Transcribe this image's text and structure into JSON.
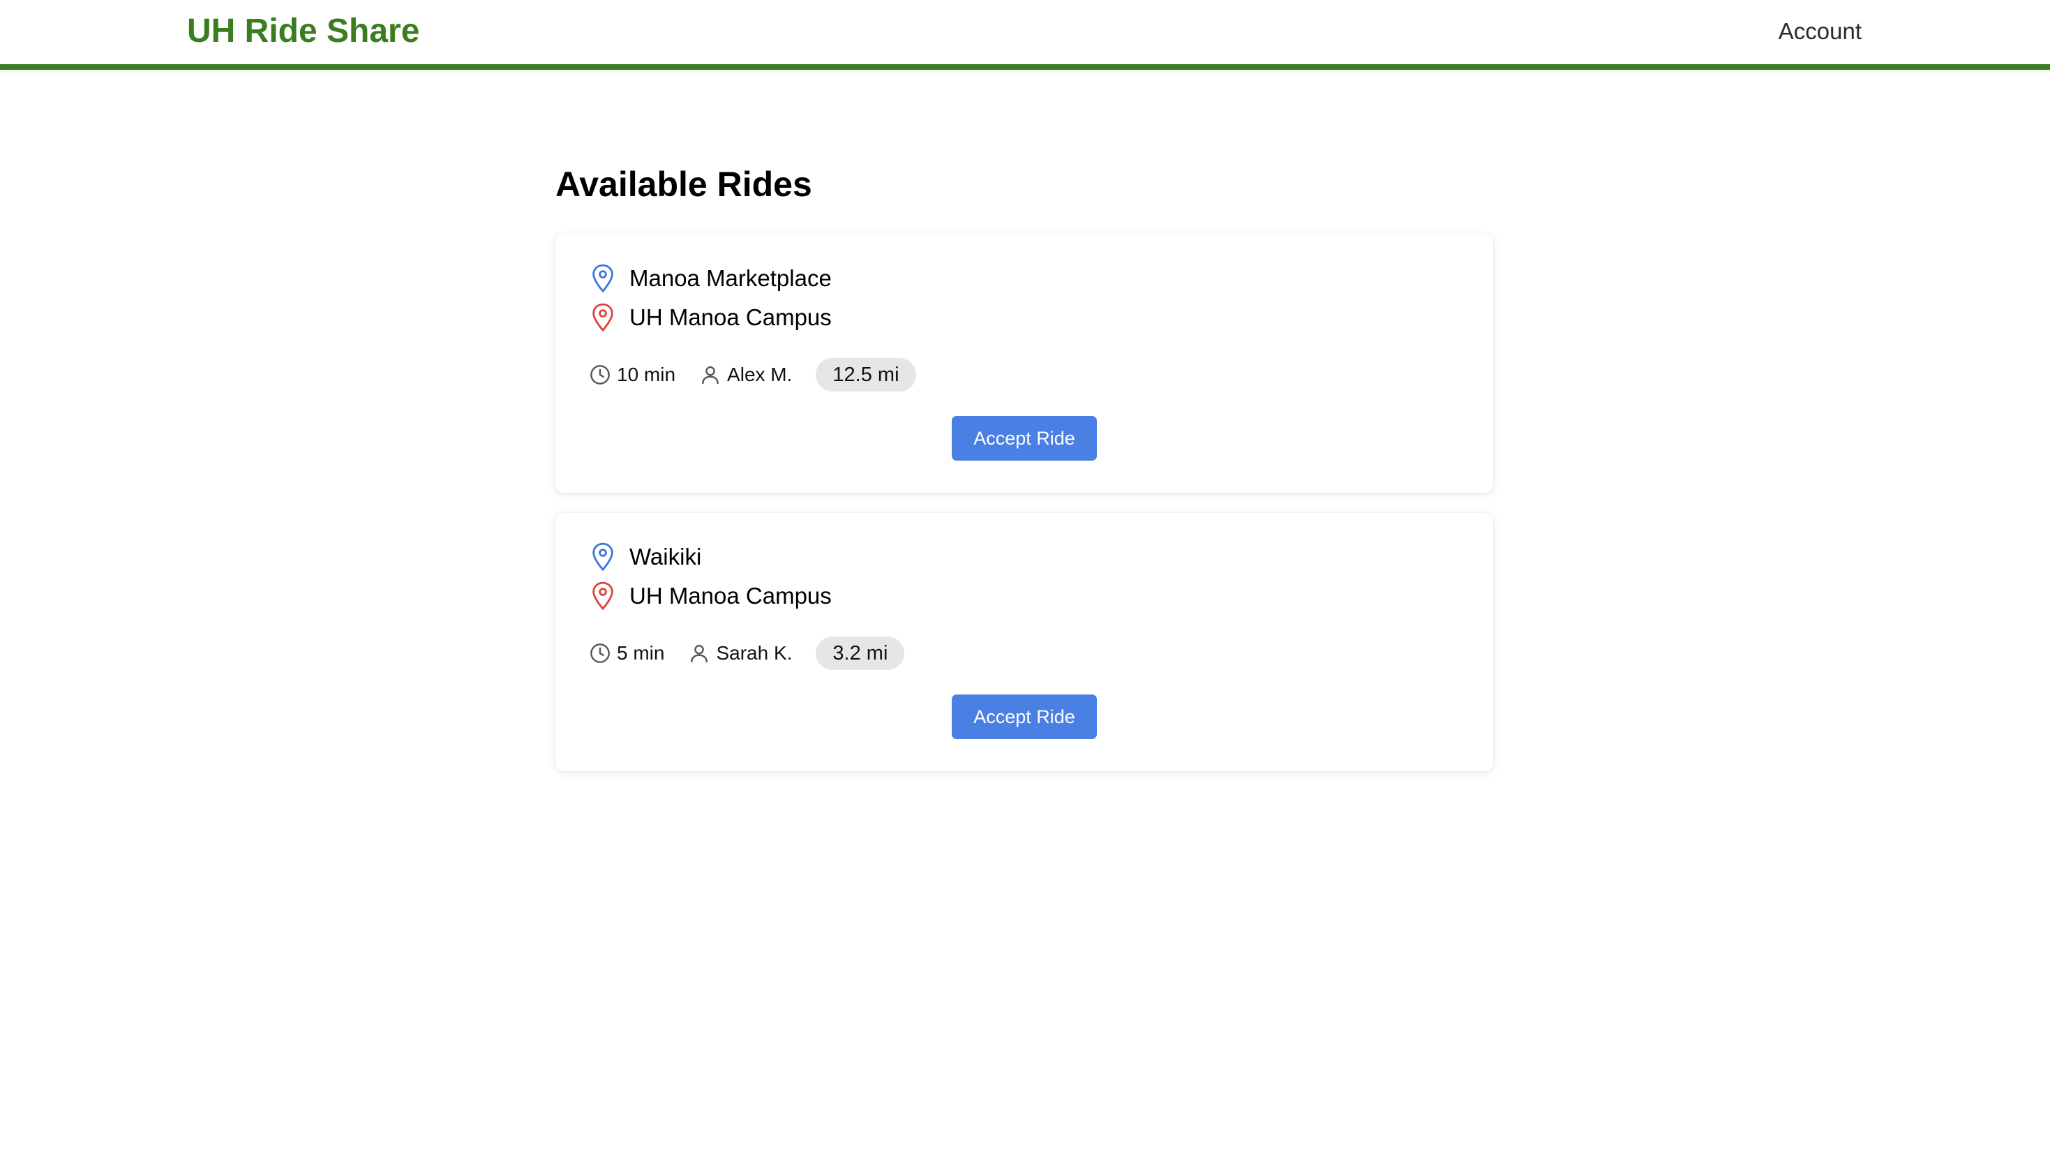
{
  "header": {
    "brand": "UH Ride Share",
    "account_label": "Account",
    "accent_color": "#3a7d1f"
  },
  "main": {
    "title": "Available Rides"
  },
  "rides": [
    {
      "origin": "Manoa Marketplace",
      "destination": "UH Manoa Campus",
      "time": "10 min",
      "driver": "Alex M.",
      "distance": "12.5 mi",
      "action_label": "Accept Ride"
    },
    {
      "origin": "Waikiki",
      "destination": "UH Manoa Campus",
      "time": "5 min",
      "driver": "Sarah K.",
      "distance": "3.2 mi",
      "action_label": "Accept Ride"
    }
  ],
  "colors": {
    "origin_pin": "#3b78e0",
    "destination_pin": "#e0433b",
    "button": "#4a80e4"
  },
  "icons": {
    "origin": "map-pin-icon",
    "destination": "map-pin-icon",
    "time": "clock-icon",
    "driver": "user-icon"
  }
}
